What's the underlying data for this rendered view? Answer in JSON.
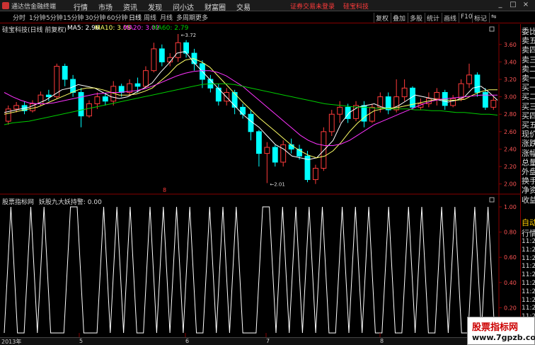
{
  "app": {
    "title": "通达信金融终端"
  },
  "menu": [
    "行情",
    "市场",
    "资讯",
    "发现",
    "问小达",
    "财富圈",
    "交易"
  ],
  "login_warning": "证券交易未登录",
  "stock_name_top": "硅宝科技",
  "window_buttons": [
    "_",
    "□",
    "×"
  ],
  "periods": [
    "分时",
    "1分钟",
    "5分钟",
    "15分钟",
    "30分钟",
    "60分钟",
    "日线",
    "周线",
    "月线",
    "多周期",
    "更多"
  ],
  "active_period": "日线",
  "toolbar_right": [
    "复权",
    "叠加",
    "多股",
    "统计",
    "画线",
    "F10",
    "标记",
    "⇋"
  ],
  "chart_header": {
    "stock": "硅宝科技(日线 前复权)",
    "ma5": "MA5: 2.96",
    "ma10": "MA10: 3.08",
    "ma20": "MA20: 3.02",
    "ma60": "MA60: 2.79"
  },
  "indicator_header": {
    "source": "股票指标网",
    "name": "妖股九大妖持警: 0.00"
  },
  "price_axis": [
    "3.60",
    "3.40",
    "3.20",
    "3.00",
    "2.80",
    "2.60",
    "2.40",
    "2.20",
    "2.00"
  ],
  "indicator_axis": [
    "1.00",
    "0.80",
    "0.60",
    "0.40",
    "0.20",
    "0.00"
  ],
  "annotations": {
    "high": "3.72",
    "low": "2.01",
    "marker": "8"
  },
  "right_panel": {
    "items": [
      "委比",
      "卖五",
      "卖四",
      "卖三",
      "卖二",
      "卖一",
      "买一",
      "买二",
      "买三",
      "买四",
      "买五",
      "现价",
      "涨跌",
      "涨幅",
      "总量",
      "外盘",
      "换手",
      "净资",
      "收益"
    ],
    "auto": "自动",
    "detail": "行情",
    "times": [
      "11:2",
      "11:2",
      "11:2",
      "11:2",
      "11:2",
      "11:2",
      "11:2",
      "11:2",
      "11:2",
      "11:2",
      "11:2",
      "11:2",
      "11:2"
    ]
  },
  "date_axis": [
    "2013年",
    "5",
    "6",
    "7",
    "8"
  ],
  "watermark": {
    "line1": "股票指标网",
    "line2": "www.7gpzb.com"
  },
  "colors": {
    "up": "#ff3b3b",
    "down": "#00ffff",
    "ma5": "#ffffff",
    "ma10": "#ffff66",
    "ma20": "#ff33ff",
    "ma60": "#00cc00"
  },
  "chart_data": [
    {
      "type": "candlestick",
      "title": "硅宝科技(日线 前复权)",
      "ylim": [
        1.9,
        3.72
      ],
      "series": [
        {
          "name": "MA5",
          "values": [
            2.82,
            2.84,
            2.86,
            2.88,
            2.92,
            2.96,
            3.02,
            3.08,
            3.1,
            3.14,
            3.12,
            3.1,
            3.05,
            3.0,
            2.98,
            3.0,
            3.05,
            3.1,
            3.16,
            3.28,
            3.38,
            3.5,
            3.52,
            3.4,
            3.3,
            3.2,
            3.1,
            3.0,
            2.9,
            2.8,
            2.72,
            2.65,
            2.55,
            2.45,
            2.4,
            2.32,
            2.3,
            2.28,
            2.3,
            2.4,
            2.5,
            2.7,
            2.82,
            2.88,
            2.9,
            2.92,
            2.88,
            2.86,
            2.9,
            2.96,
            3.02,
            3.0,
            2.98,
            2.96,
            2.94,
            2.96,
            3.0,
            3.1,
            3.12,
            3.05,
            2.96
          ]
        },
        {
          "name": "MA10",
          "values": [
            2.8,
            2.82,
            2.84,
            2.86,
            2.88,
            2.92,
            2.96,
            3.0,
            3.04,
            3.08,
            3.1,
            3.1,
            3.08,
            3.05,
            3.02,
            3.02,
            3.03,
            3.06,
            3.1,
            3.18,
            3.26,
            3.36,
            3.42,
            3.44,
            3.4,
            3.34,
            3.24,
            3.14,
            3.04,
            2.94,
            2.85,
            2.76,
            2.68,
            2.6,
            2.52,
            2.44,
            2.38,
            2.33,
            2.3,
            2.32,
            2.38,
            2.48,
            2.6,
            2.7,
            2.78,
            2.84,
            2.86,
            2.87,
            2.88,
            2.9,
            2.92,
            2.94,
            2.96,
            2.97,
            2.96,
            2.96,
            2.97,
            3.02,
            3.06,
            3.08,
            3.08
          ]
        },
        {
          "name": "MA20",
          "values": [
            3.05,
            3.0,
            2.96,
            2.93,
            2.92,
            2.92,
            2.93,
            2.95,
            2.97,
            2.99,
            3.01,
            3.03,
            3.04,
            3.05,
            3.05,
            3.06,
            3.07,
            3.09,
            3.12,
            3.16,
            3.2,
            3.24,
            3.27,
            3.29,
            3.3,
            3.3,
            3.28,
            3.24,
            3.18,
            3.12,
            3.04,
            2.96,
            2.88,
            2.8,
            2.72,
            2.64,
            2.56,
            2.5,
            2.46,
            2.44,
            2.44,
            2.46,
            2.5,
            2.56,
            2.62,
            2.68,
            2.72,
            2.76,
            2.8,
            2.84,
            2.88,
            2.92,
            2.95,
            2.97,
            2.98,
            2.99,
            3.0,
            3.01,
            3.02,
            3.02,
            3.02
          ]
        },
        {
          "name": "MA60",
          "values": [
            2.68,
            2.7,
            2.71,
            2.72,
            2.74,
            2.76,
            2.78,
            2.8,
            2.82,
            2.84,
            2.86,
            2.88,
            2.9,
            2.92,
            2.94,
            2.96,
            2.98,
            3.0,
            3.02,
            3.04,
            3.06,
            3.08,
            3.1,
            3.12,
            3.14,
            3.15,
            3.15,
            3.15,
            3.14,
            3.12,
            3.1,
            3.08,
            3.06,
            3.04,
            3.02,
            3.0,
            2.98,
            2.96,
            2.94,
            2.92,
            2.91,
            2.9,
            2.89,
            2.88,
            2.88,
            2.87,
            2.87,
            2.86,
            2.86,
            2.86,
            2.85,
            2.85,
            2.84,
            2.84,
            2.83,
            2.82,
            2.82,
            2.81,
            2.8,
            2.8,
            2.79
          ]
        }
      ],
      "candles": [
        [
          2.72,
          2.86,
          2.68,
          2.9
        ],
        [
          2.86,
          2.9,
          2.82,
          2.94
        ],
        [
          2.9,
          2.84,
          2.8,
          2.95
        ],
        [
          2.84,
          2.92,
          2.82,
          2.96
        ],
        [
          2.92,
          3.02,
          2.9,
          3.06
        ],
        [
          3.02,
          3.0,
          2.95,
          3.08
        ],
        [
          3.0,
          3.35,
          2.98,
          3.38
        ],
        [
          3.35,
          3.2,
          3.12,
          3.38
        ],
        [
          3.2,
          3.05,
          3.0,
          3.25
        ],
        [
          3.05,
          2.78,
          2.65,
          3.1
        ],
        [
          2.78,
          2.92,
          2.76,
          2.96
        ],
        [
          2.92,
          3.0,
          2.86,
          3.05
        ],
        [
          3.0,
          2.95,
          2.9,
          3.04
        ],
        [
          2.95,
          3.12,
          2.9,
          3.18
        ],
        [
          3.12,
          3.05,
          3.0,
          3.15
        ],
        [
          3.05,
          3.15,
          3.02,
          3.2
        ],
        [
          3.15,
          3.12,
          3.05,
          3.22
        ],
        [
          3.12,
          3.3,
          3.1,
          3.35
        ],
        [
          3.3,
          3.55,
          3.28,
          3.62
        ],
        [
          3.55,
          3.4,
          3.35,
          3.6
        ],
        [
          3.4,
          3.45,
          3.35,
          3.5
        ],
        [
          3.45,
          3.62,
          3.4,
          3.72
        ],
        [
          3.62,
          3.5,
          3.45,
          3.65
        ],
        [
          3.5,
          3.38,
          3.3,
          3.55
        ],
        [
          3.38,
          3.2,
          3.1,
          3.42
        ],
        [
          3.2,
          3.1,
          3.05,
          3.25
        ],
        [
          3.1,
          2.95,
          2.9,
          3.15
        ],
        [
          2.95,
          3.05,
          2.9,
          3.1
        ],
        [
          3.05,
          2.88,
          2.8,
          3.08
        ],
        [
          2.88,
          2.8,
          2.75,
          2.92
        ],
        [
          2.8,
          2.6,
          2.5,
          2.85
        ],
        [
          2.6,
          2.35,
          2.2,
          2.62
        ],
        [
          2.35,
          2.42,
          2.01,
          2.48
        ],
        [
          2.42,
          2.25,
          2.2,
          2.45
        ],
        [
          2.25,
          2.45,
          2.2,
          2.5
        ],
        [
          2.45,
          2.4,
          2.35,
          2.52
        ],
        [
          2.4,
          2.32,
          2.28,
          2.45
        ],
        [
          2.32,
          2.05,
          2.02,
          2.38
        ],
        [
          2.05,
          2.18,
          2.0,
          2.22
        ],
        [
          2.18,
          2.6,
          2.15,
          2.65
        ],
        [
          2.6,
          2.8,
          2.55,
          2.85
        ],
        [
          2.8,
          2.88,
          2.7,
          2.95
        ],
        [
          2.88,
          2.75,
          2.7,
          2.92
        ],
        [
          2.75,
          2.9,
          2.72,
          2.95
        ],
        [
          2.9,
          2.72,
          2.65,
          2.95
        ],
        [
          2.72,
          2.88,
          2.7,
          2.92
        ],
        [
          2.88,
          3.0,
          2.82,
          3.05
        ],
        [
          3.0,
          2.85,
          2.8,
          3.05
        ],
        [
          2.85,
          3.0,
          2.82,
          3.2
        ],
        [
          3.0,
          3.1,
          2.95,
          3.2
        ],
        [
          3.1,
          2.88,
          2.85,
          3.12
        ],
        [
          2.88,
          2.92,
          2.85,
          2.98
        ],
        [
          2.92,
          2.98,
          2.88,
          3.05
        ],
        [
          2.98,
          3.05,
          2.9,
          3.1
        ],
        [
          3.05,
          2.9,
          2.85,
          3.08
        ],
        [
          2.9,
          2.98,
          2.88,
          3.02
        ],
        [
          2.98,
          3.15,
          2.95,
          3.2
        ],
        [
          3.15,
          3.25,
          3.1,
          3.38
        ],
        [
          3.25,
          3.05,
          3.0,
          3.28
        ],
        [
          3.05,
          2.88,
          2.85,
          3.1
        ],
        [
          2.88,
          2.96,
          2.85,
          3.0
        ]
      ]
    },
    {
      "type": "line",
      "title": "妖股九大妖持警",
      "ylim": [
        0,
        1
      ],
      "series": [
        {
          "name": "妖股九大妖持警",
          "values": [
            0,
            1,
            0,
            0,
            1,
            0,
            1,
            0,
            0,
            0,
            1,
            1,
            0,
            0,
            0,
            1,
            0,
            1,
            0,
            1,
            0,
            0,
            1,
            0,
            1,
            0,
            1,
            0,
            1,
            0,
            0,
            1,
            0,
            1,
            0,
            1,
            0,
            0,
            0,
            1,
            1,
            0,
            1,
            0,
            1,
            0,
            1,
            0,
            1,
            0,
            0,
            1,
            0,
            1,
            0,
            1,
            0,
            0,
            1,
            0,
            0,
            1,
            0,
            1,
            0,
            0,
            1,
            0,
            1,
            0,
            0,
            1,
            0,
            1,
            0
          ]
        }
      ]
    }
  ]
}
